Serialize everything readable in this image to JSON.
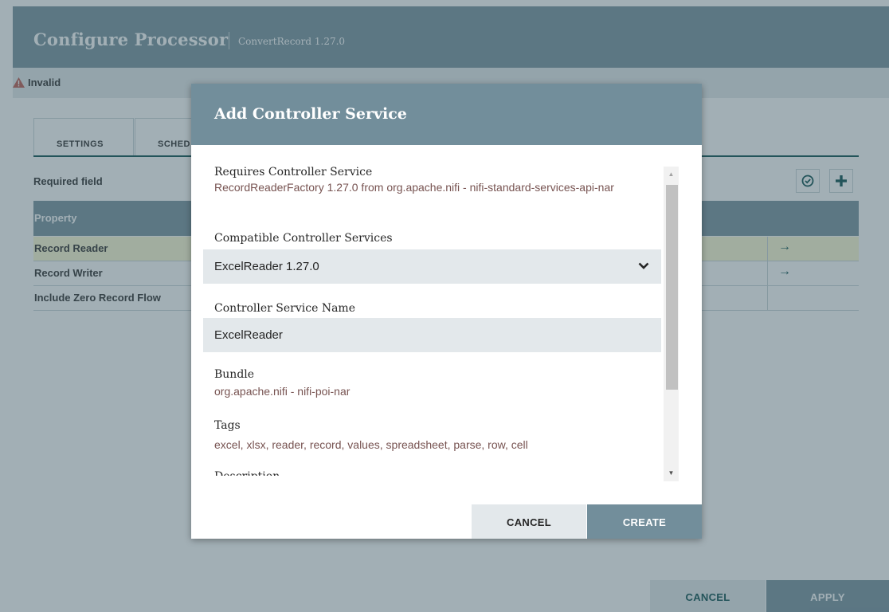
{
  "processor_dialog": {
    "title": "Configure Processor",
    "subtitle": "ConvertRecord 1.27.0",
    "status": "Invalid",
    "tabs": [
      {
        "label": "SETTINGS"
      },
      {
        "label": "SCHED"
      }
    ],
    "required_field_label": "Required field",
    "table": {
      "column_header": "Property",
      "rows": [
        {
          "property": "Record Reader",
          "arrow": "→",
          "selected": true
        },
        {
          "property": "Record Writer",
          "arrow": "→",
          "selected": false
        },
        {
          "property": "Include Zero Record Flow",
          "arrow": "",
          "selected": false
        }
      ]
    },
    "cancel_label": "CANCEL",
    "apply_label": "APPLY"
  },
  "add_service_dialog": {
    "title": "Add Controller Service",
    "requires_label": "Requires Controller Service",
    "requires_value": "RecordReaderFactory 1.27.0 from org.apache.nifi - nifi-standard-services-api-nar",
    "compatible_label": "Compatible Controller Services",
    "compatible_selected": "ExcelReader 1.27.0",
    "name_label": "Controller Service Name",
    "name_value": "ExcelReader",
    "bundle_label": "Bundle",
    "bundle_value": "org.apache.nifi - nifi-poi-nar",
    "tags_label": "Tags",
    "tags_value": "excel, xlsx, reader, record, values, spreadsheet, parse, row, cell",
    "description_label": "Description",
    "cancel_label": "CANCEL",
    "create_label": "CREATE"
  },
  "icons": {
    "status": "warning-icon",
    "verify": "check-circle-icon",
    "add": "plus-icon",
    "select": "chevron-down-icon",
    "row_action": "arrow-right-icon"
  },
  "colors": {
    "header": "#728e9b",
    "accent": "#004849",
    "value_text": "#775351",
    "warning": "#ba554a",
    "selected_row": "#fdfbd3",
    "field_bg": "#e3e8eb"
  }
}
